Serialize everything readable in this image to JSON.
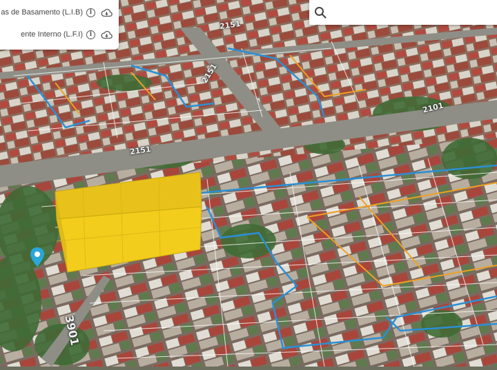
{
  "layers_panel": {
    "items": [
      {
        "label": "as de Basamento (L.I.B)",
        "info_icon": "info-icon",
        "download_icon": "cloud-download-icon"
      },
      {
        "label": "ente Interno (L.F.I)",
        "info_icon": "info-icon",
        "download_icon": "cloud-download-icon"
      }
    ]
  },
  "search": {
    "value": "",
    "placeholder": "",
    "icon": "search-icon"
  },
  "map": {
    "street_labels": [
      "2151",
      "2151",
      "2101",
      "2151",
      "3901"
    ],
    "colors": {
      "building": "#f2cd1c",
      "lot_line_blue": "#2a8fd6",
      "lot_line_orange": "#f0a020",
      "marker": "#2aa6d8"
    },
    "marker_icon": "map-pin-icon"
  }
}
